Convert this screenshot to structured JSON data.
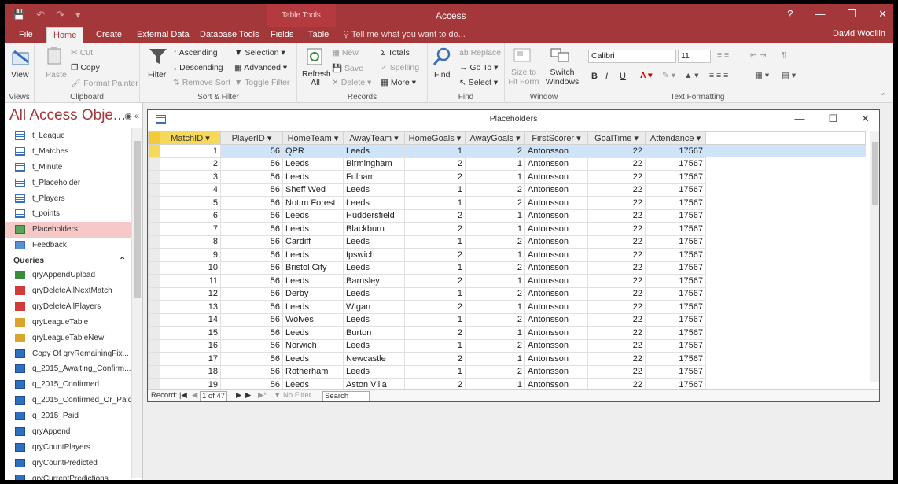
{
  "app": {
    "title": "Access",
    "context_tab": "Table Tools",
    "user": "David Woollin",
    "tell_me": "Tell me what you want to do...",
    "help": "?"
  },
  "tabs": [
    "File",
    "Home",
    "Create",
    "External Data",
    "Database Tools",
    "Fields",
    "Table"
  ],
  "ribbon": {
    "views": {
      "label": "Views",
      "view": "View"
    },
    "clipboard": {
      "label": "Clipboard",
      "paste": "Paste",
      "cut": "Cut",
      "copy": "Copy",
      "painter": "Format Painter"
    },
    "sort": {
      "label": "Sort & Filter",
      "filter": "Filter",
      "asc": "Ascending",
      "desc": "Descending",
      "remove": "Remove Sort",
      "selection": "Selection",
      "advanced": "Advanced",
      "toggle": "Toggle Filter"
    },
    "records": {
      "label": "Records",
      "refresh": "Refresh All",
      "new": "New",
      "save": "Save",
      "delete": "Delete",
      "totals": "Totals",
      "spelling": "Spelling",
      "more": "More"
    },
    "find": {
      "label": "Find",
      "find": "Find",
      "replace": "Replace",
      "goto": "Go To",
      "select": "Select"
    },
    "window": {
      "label": "Window",
      "size": "Size to Fit Form",
      "switch": "Switch Windows"
    },
    "text": {
      "label": "Text Formatting",
      "font": "Calibri",
      "size": "11",
      "bold": "B",
      "italic": "I",
      "underline": "U"
    }
  },
  "nav": {
    "title": "All Access Obje...",
    "tables": [
      "t_League",
      "t_Matches",
      "t_Minute",
      "t_Placeholder",
      "t_Players",
      "t_points"
    ],
    "forms": [
      "Placeholders",
      "Feedback"
    ],
    "queries_header": "Queries",
    "queries": [
      "qryAppendUpload",
      "qryDeleteAllNextMatch",
      "qryDeleteAllPlayers",
      "qryLeagueTable",
      "qryLeagueTableNew",
      "Copy Of qryRemainingFix...",
      "q_2015_Awaiting_Confirm...",
      "q_2015_Confirmed",
      "q_2015_Confirmed_Or_Paid",
      "q_2015_Paid",
      "qryAppend",
      "qryCountPlayers",
      "qryCountPredicted",
      "qryCurrentPredictions"
    ]
  },
  "datasheet": {
    "title": "Placeholders",
    "columns": [
      "MatchID",
      "PlayerID",
      "HomeTeam",
      "AwayTeam",
      "HomeGoals",
      "AwayGoals",
      "FirstScorer",
      "GoalTime",
      "Attendance"
    ],
    "rows": [
      [
        1,
        56,
        "QPR",
        "Leeds",
        1,
        2,
        "Antonsson",
        22,
        17567
      ],
      [
        2,
        56,
        "Leeds",
        "Birmingham",
        2,
        1,
        "Antonsson",
        22,
        17567
      ],
      [
        3,
        56,
        "Leeds",
        "Fulham",
        2,
        1,
        "Antonsson",
        22,
        17567
      ],
      [
        4,
        56,
        "Sheff Wed",
        "Leeds",
        1,
        2,
        "Antonsson",
        22,
        17567
      ],
      [
        5,
        56,
        "Nottm Forest",
        "Leeds",
        1,
        2,
        "Antonsson",
        22,
        17567
      ],
      [
        6,
        56,
        "Leeds",
        "Huddersfield",
        2,
        1,
        "Antonsson",
        22,
        17567
      ],
      [
        7,
        56,
        "Leeds",
        "Blackburn",
        2,
        1,
        "Antonsson",
        22,
        17567
      ],
      [
        8,
        56,
        "Cardiff",
        "Leeds",
        1,
        2,
        "Antonsson",
        22,
        17567
      ],
      [
        9,
        56,
        "Leeds",
        "Ipswich",
        2,
        1,
        "Antonsson",
        22,
        17567
      ],
      [
        10,
        56,
        "Bristol City",
        "Leeds",
        1,
        2,
        "Antonsson",
        22,
        17567
      ],
      [
        11,
        56,
        "Leeds",
        "Barnsley",
        2,
        1,
        "Antonsson",
        22,
        17567
      ],
      [
        12,
        56,
        "Derby",
        "Leeds",
        1,
        2,
        "Antonsson",
        22,
        17567
      ],
      [
        13,
        56,
        "Leeds",
        "Wigan",
        2,
        1,
        "Antonsson",
        22,
        17567
      ],
      [
        14,
        56,
        "Wolves",
        "Leeds",
        1,
        2,
        "Antonsson",
        22,
        17567
      ],
      [
        15,
        56,
        "Leeds",
        "Burton",
        2,
        1,
        "Antonsson",
        22,
        17567
      ],
      [
        16,
        56,
        "Norwich",
        "Leeds",
        1,
        2,
        "Antonsson",
        22,
        17567
      ],
      [
        17,
        56,
        "Leeds",
        "Newcastle",
        2,
        1,
        "Antonsson",
        22,
        17567
      ],
      [
        18,
        56,
        "Rotherham",
        "Leeds",
        1,
        2,
        "Antonsson",
        22,
        17567
      ],
      [
        19,
        56,
        "Leeds",
        "Aston Villa",
        2,
        1,
        "Antonsson",
        22,
        17567
      ]
    ],
    "record_label": "Record:",
    "record_position": "1 of 47",
    "no_filter": "No Filter",
    "search": "Search"
  }
}
